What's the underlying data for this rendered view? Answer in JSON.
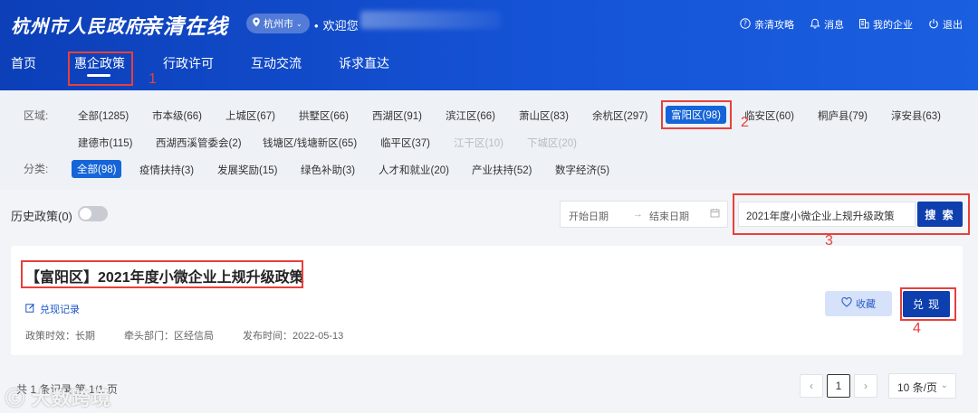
{
  "header": {
    "logo_text": "杭州市人民政府",
    "brand_text": "亲清在线",
    "city": "杭州市",
    "welcome": "欢迎您",
    "tools": [
      {
        "icon": "help-icon",
        "label": "亲清攻略"
      },
      {
        "icon": "bell-icon",
        "label": "消息"
      },
      {
        "icon": "building-icon",
        "label": "我的企业"
      },
      {
        "icon": "power-icon",
        "label": "退出"
      }
    ]
  },
  "nav": {
    "items": [
      "首页",
      "惠企政策",
      "行政许可",
      "互动交流",
      "诉求直达"
    ],
    "active": "惠企政策"
  },
  "filters": {
    "region_label": "区域:",
    "regions_row1": [
      "全部(1285)",
      "市本级(66)",
      "上城区(67)",
      "拱墅区(66)",
      "西湖区(91)",
      "滨江区(66)",
      "萧山区(83)",
      "余杭区(297)",
      "富阳区(98)",
      "临安区(60)",
      "桐庐县(79)",
      "淳安县(63)"
    ],
    "regions_row2": [
      "建德市(115)",
      "西湖西溪管委会(2)",
      "钱塘区/钱塘新区(65)",
      "临平区(37)",
      "江干区(10)",
      "下城区(20)"
    ],
    "active_region": "富阳区(98)",
    "category_label": "分类:",
    "categories": [
      "全部(98)",
      "疫情扶持(3)",
      "发展奖励(15)",
      "绿色补助(3)",
      "人才和就业(20)",
      "产业扶持(52)",
      "数字经济(5)"
    ],
    "active_category": "全部(98)"
  },
  "toolbar": {
    "history_label": "历史政策(0)",
    "start_date_placeholder": "开始日期",
    "end_date_placeholder": "结束日期",
    "search_value": "2021年度小微企业上规升级政策",
    "search_button": "搜 索"
  },
  "result": {
    "title": "【富阳区】2021年度小微企业上规升级政策",
    "record_link": "兑现记录",
    "validity": "政策时效：长期",
    "department": "牵头部门：区经信局",
    "publish_time": "发布时间：2022-05-13",
    "favorite_label": "收藏",
    "redeem_label": "兑 现"
  },
  "pagination": {
    "summary": "共 1 条记录 第 1/1 页",
    "current_page": "1",
    "page_size": "10 条/页"
  },
  "watermark": "大数跨境",
  "annotations": [
    "1",
    "2",
    "3",
    "4"
  ],
  "colors": {
    "header_blue": "#1553d6",
    "primary_button": "#0e3fae",
    "active_tag": "#1565d8",
    "annotation_red": "#e8403b"
  }
}
